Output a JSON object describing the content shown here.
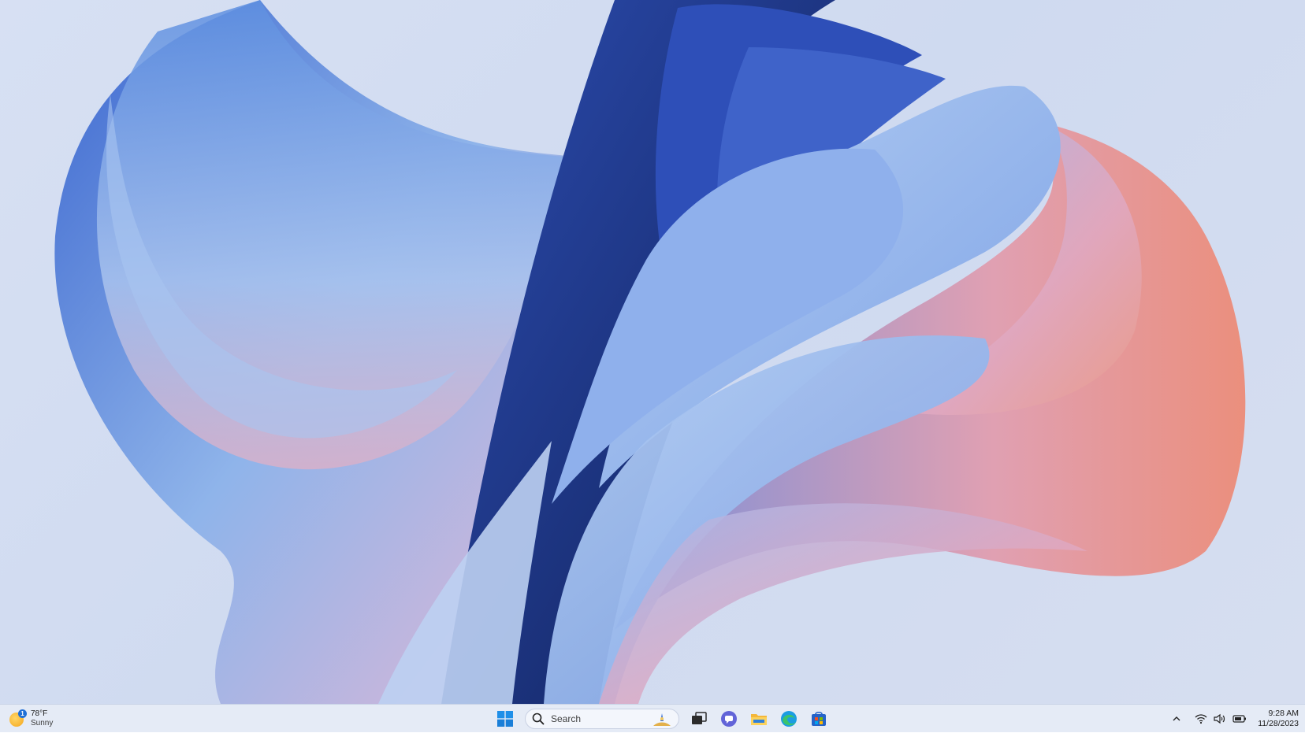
{
  "desktop": {
    "wallpaper": "bloom-wallpaper",
    "colors": {
      "background": "#d7e0f3",
      "blue_light": "#8fb4ea",
      "blue_mid": "#4a79d6",
      "blue_deep": "#233f9a",
      "navy": "#0f1f55",
      "pink": "#e9a9b6",
      "coral": "#e9927f"
    }
  },
  "taskbar": {
    "weather": {
      "temperature": "78°F",
      "condition": "Sunny",
      "badge": "1",
      "icon": "sun-icon"
    },
    "start": {
      "icon": "windows-start-icon"
    },
    "search": {
      "placeholder": "Search",
      "icon": "search-icon"
    },
    "apps": [
      {
        "name": "task-view",
        "icon": "task-view-icon"
      },
      {
        "name": "teams-chat",
        "icon": "chat-icon"
      },
      {
        "name": "file-explorer",
        "icon": "folder-icon"
      },
      {
        "name": "edge",
        "icon": "edge-icon"
      },
      {
        "name": "store",
        "icon": "store-icon"
      }
    ],
    "tray": {
      "icons": [
        "chevron-up-icon",
        "wifi-icon",
        "volume-icon",
        "battery-icon"
      ],
      "time": "9:28 AM",
      "date": "11/28/2023"
    }
  }
}
